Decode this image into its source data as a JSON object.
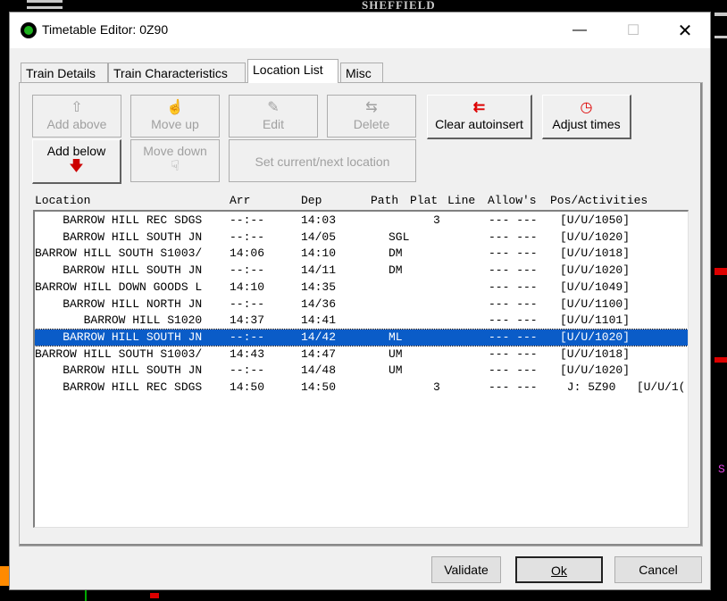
{
  "background": {
    "caption": "SHEFFIELD",
    "side_text": "S"
  },
  "window": {
    "title": "Timetable Editor: 0Z90",
    "minimize": "—",
    "maximize": "☐",
    "close": "✕"
  },
  "tabs": [
    {
      "label": "Train Details"
    },
    {
      "label": "Train Characteristics"
    },
    {
      "label": "Location List"
    },
    {
      "label": "Misc"
    }
  ],
  "toolbar": {
    "add_above": "Add above",
    "move_up": "Move up",
    "edit": "Edit",
    "delete": "Delete",
    "clear_autoinsert": "Clear autoinsert",
    "adjust_times": "Adjust times",
    "add_below": "Add below",
    "move_down": "Move down",
    "set_location": "Set current/next location"
  },
  "columns": {
    "location": "Location",
    "arr": "Arr",
    "dep": "Dep",
    "path": "Path",
    "plat": "Plat",
    "line": "Line",
    "allows": "Allow's",
    "pos": "Pos/Activities"
  },
  "rows": [
    {
      "location": "    BARROW HILL REC SDGS",
      "arr": "--:--",
      "dep": "14:03",
      "path": "",
      "plat": "3",
      "allow": "--- ---",
      "pos": "[U/U/1050]"
    },
    {
      "location": "    BARROW HILL SOUTH JN",
      "arr": "--:--",
      "dep": "14/05",
      "path": "SGL",
      "plat": "",
      "allow": "--- ---",
      "pos": "[U/U/1020]"
    },
    {
      "location": "BARROW HILL SOUTH S1003/",
      "arr": "14:06",
      "dep": "14:10",
      "path": "DM",
      "plat": "",
      "allow": "--- ---",
      "pos": "[U/U/1018]"
    },
    {
      "location": "    BARROW HILL SOUTH JN",
      "arr": "--:--",
      "dep": "14/11",
      "path": "DM",
      "plat": "",
      "allow": "--- ---",
      "pos": "[U/U/1020]"
    },
    {
      "location": "BARROW HILL DOWN GOODS L",
      "arr": "14:10",
      "dep": "14:35",
      "path": "",
      "plat": "",
      "allow": "--- ---",
      "pos": "[U/U/1049]"
    },
    {
      "location": "    BARROW HILL NORTH JN",
      "arr": "--:--",
      "dep": "14/36",
      "path": "",
      "plat": "",
      "allow": "--- ---",
      "pos": "[U/U/1100]"
    },
    {
      "location": "       BARROW HILL S1020",
      "arr": "14:37",
      "dep": "14:41",
      "path": "",
      "plat": "",
      "allow": "--- ---",
      "pos": "[U/U/1101]"
    },
    {
      "location": "    BARROW HILL SOUTH JN",
      "arr": "--:--",
      "dep": "14/42",
      "path": "ML",
      "plat": "",
      "allow": "--- ---",
      "pos": "[U/U/1020]"
    },
    {
      "location": "BARROW HILL SOUTH S1003/",
      "arr": "14:43",
      "dep": "14:47",
      "path": "UM",
      "plat": "",
      "allow": "--- ---",
      "pos": "[U/U/1018]"
    },
    {
      "location": "    BARROW HILL SOUTH JN",
      "arr": "--:--",
      "dep": "14/48",
      "path": "UM",
      "plat": "",
      "allow": "--- ---",
      "pos": "[U/U/1020]"
    },
    {
      "location": "    BARROW HILL REC SDGS",
      "arr": "14:50",
      "dep": "14:50",
      "path": "",
      "plat": "3",
      "allow": "--- ---",
      "pos": " J: 5Z90   [U/U/1("
    }
  ],
  "buttons": {
    "validate": "Validate",
    "ok": "Ok",
    "cancel": "Cancel"
  }
}
